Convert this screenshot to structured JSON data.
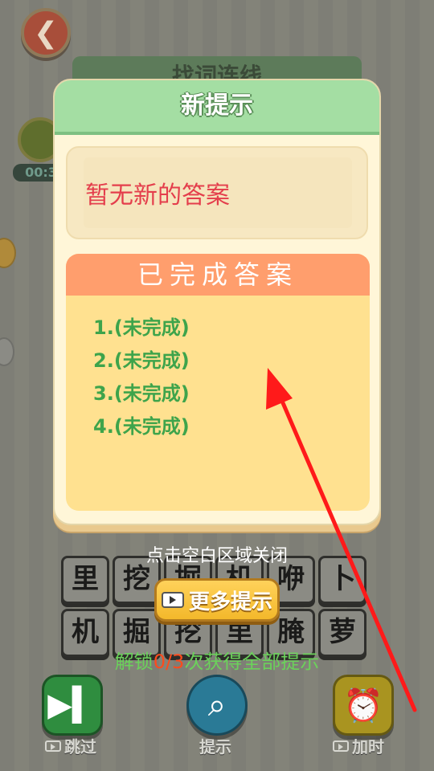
{
  "game": {
    "title_bar_text": "找词连线",
    "timer_text": "00:3",
    "grid_rows": [
      [
        "",
        "",
        "",
        "",
        "",
        ""
      ],
      [
        "里",
        "挖",
        "掘",
        "机",
        "咿",
        "卜"
      ],
      [
        "机",
        "掘",
        "挖",
        "里",
        "腌",
        "萝"
      ]
    ],
    "close_hint": "点击空白区域关闭",
    "more_hints_label": "更多提示",
    "unlock": {
      "prefix": "解锁",
      "count": "0/3",
      "suffix": "次获得全部提示"
    },
    "bottom_buttons": {
      "skip_label": "跳过",
      "hint_label": "提示",
      "time_label": "加时"
    }
  },
  "dialog": {
    "title": "新提示",
    "new_hint_text": "暂无新的答案",
    "completed_title": "已完成答案",
    "answers": [
      "1.(未完成)",
      "2.(未完成)",
      "3.(未完成)",
      "4.(未完成)"
    ]
  },
  "colors": {
    "dialog_header": "#a4dea3",
    "completed_header": "#ff9e6d",
    "answer_text": "#3ea44b",
    "new_hint_text": "#e43e4c",
    "annotation_arrow": "#ff1a1a"
  },
  "icons": {
    "back": "arrow-left-icon",
    "skip": "skip-forward-icon",
    "hint": "magnifier-icon",
    "time": "alarm-clock-icon",
    "video": "video-camera-icon"
  }
}
